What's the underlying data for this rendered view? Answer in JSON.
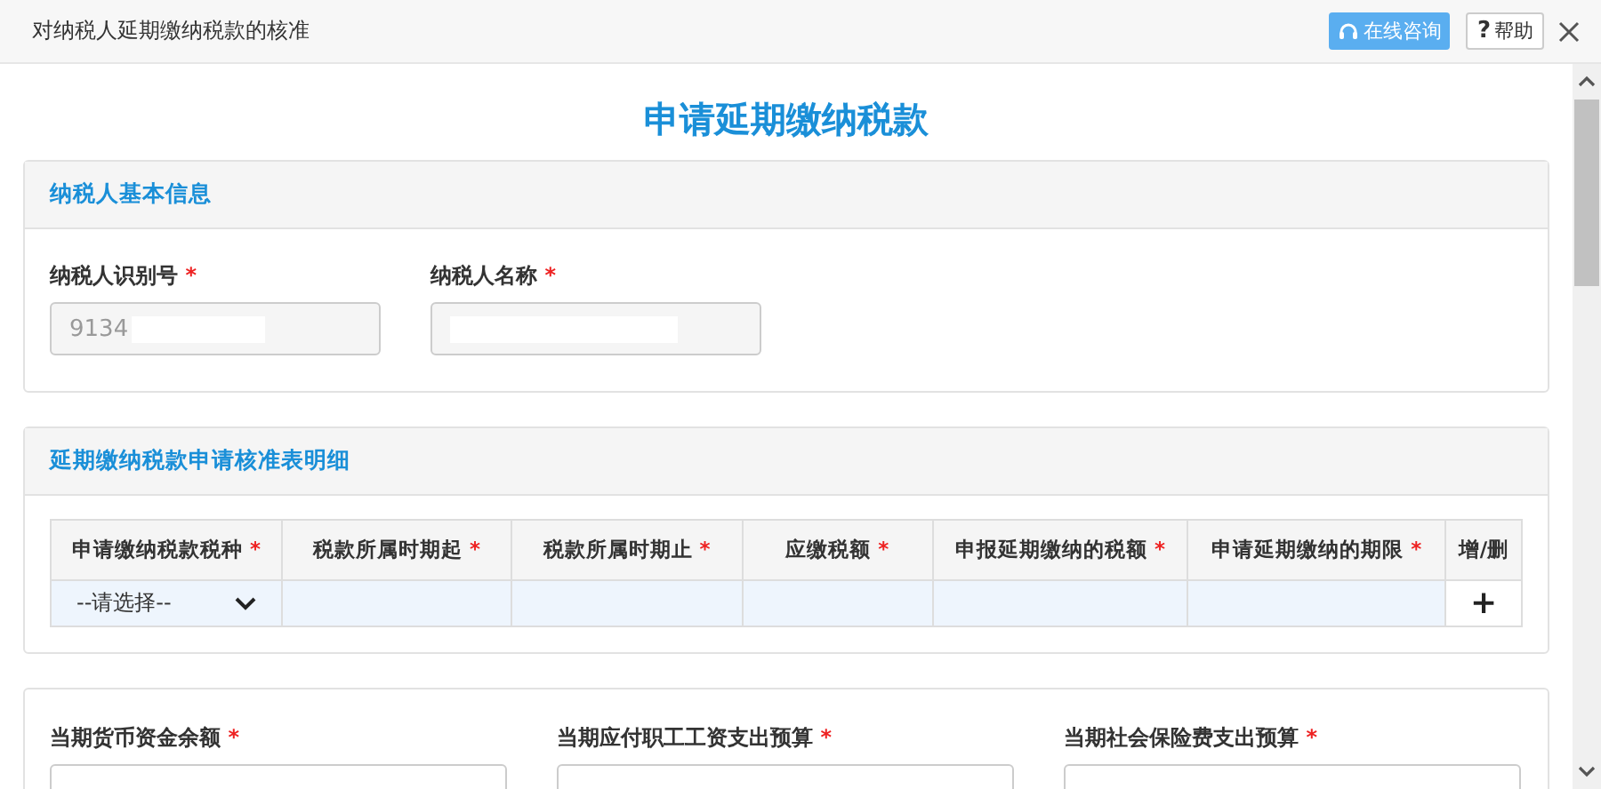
{
  "window": {
    "title": "对纳税人延期缴纳税款的核准",
    "buttons": [
      {
        "kind": "consult",
        "label": "在线咨询"
      },
      {
        "kind": "help",
        "label": "帮助",
        "glyph": "?"
      }
    ]
  },
  "page_title": "申请延期缴纳税款",
  "basic_info": {
    "title": "纳税人基本信息",
    "fields": [
      {
        "label": "纳税人识别号",
        "required_mark": "*",
        "value": "9134",
        "redacted": true
      },
      {
        "label": "纳税人名称",
        "required_mark": "*",
        "redacted": true
      }
    ]
  },
  "detail": {
    "title": "延期缴纳税款申请核准表明细",
    "columns": [
      {
        "label": "申请缴纳税款税种",
        "required_mark": "*"
      },
      {
        "label": "税款所属时期起",
        "required_mark": "*"
      },
      {
        "label": "税款所属时期止",
        "required_mark": "*"
      },
      {
        "label": "应缴税额",
        "required_mark": "*"
      },
      {
        "label": "申报延期缴纳的税额",
        "required_mark": "*"
      },
      {
        "label": "申请延期缴纳的期限",
        "required_mark": "*"
      },
      {
        "label": "增/删"
      }
    ],
    "rows": [
      {
        "tax_type": "--请选择--",
        "add": "+"
      }
    ]
  },
  "budget": {
    "fields": [
      {
        "label": "当期货币资金余额",
        "required_mark": "*"
      },
      {
        "label": "当期应付职工工资支出预算",
        "required_mark": "*"
      },
      {
        "label": "当期社会保险费支出预算",
        "required_mark": "*"
      }
    ]
  }
}
